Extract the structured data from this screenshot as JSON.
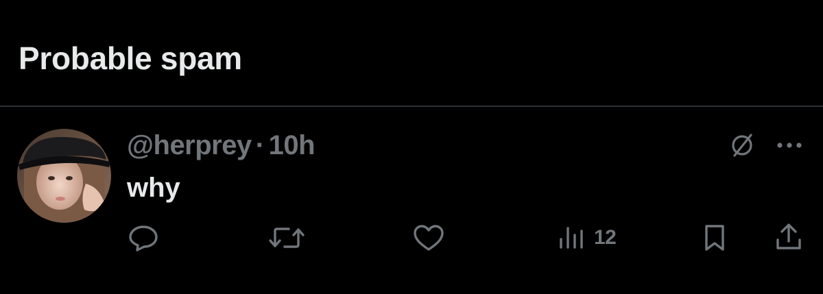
{
  "section": {
    "title": "Probable spam"
  },
  "tweet": {
    "handle": "@herprey",
    "separator": "·",
    "time": "10h",
    "text": "why",
    "avatar_icon": "user-avatar-photo"
  },
  "actions": {
    "reply_icon": "reply-icon",
    "retweet_icon": "retweet-icon",
    "like_icon": "heart-icon",
    "views_icon": "views-chart-icon",
    "views_count": "12",
    "bookmark_icon": "bookmark-icon",
    "share_icon": "share-icon",
    "more_icon": "more-dots-icon",
    "grok_icon": "slashed-circle-icon"
  },
  "colors": {
    "background": "#000000",
    "primary_text": "#e7e9ea",
    "secondary_text": "#71767b",
    "divider": "#2f3336"
  }
}
